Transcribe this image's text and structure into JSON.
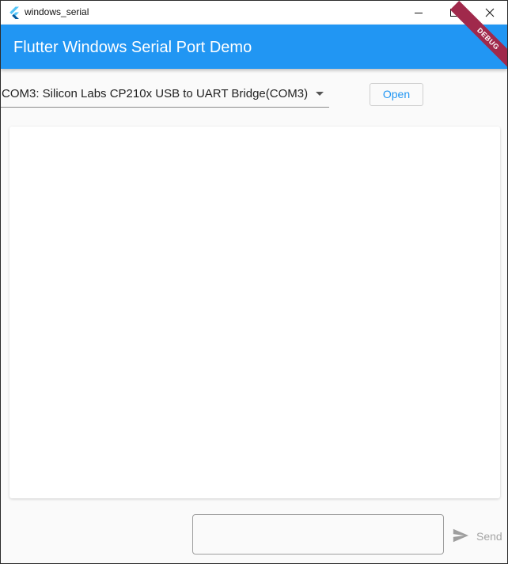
{
  "window": {
    "title": "windows_serial"
  },
  "appbar": {
    "title": "Flutter Windows Serial Port Demo",
    "debug_banner": "DEBUG",
    "color": "#2196f3"
  },
  "controls": {
    "port_selected": "COM3: Silicon Labs CP210x USB to UART Bridge(COM3)",
    "open_label": "Open"
  },
  "output": {
    "text": ""
  },
  "input": {
    "value": "",
    "send_label": "Send"
  },
  "icons": {
    "app": "flutter-logo-icon",
    "minimize": "minimize-icon",
    "maximize": "maximize-icon",
    "close": "close-icon",
    "dropdown": "dropdown-arrow-icon",
    "send": "send-icon"
  }
}
